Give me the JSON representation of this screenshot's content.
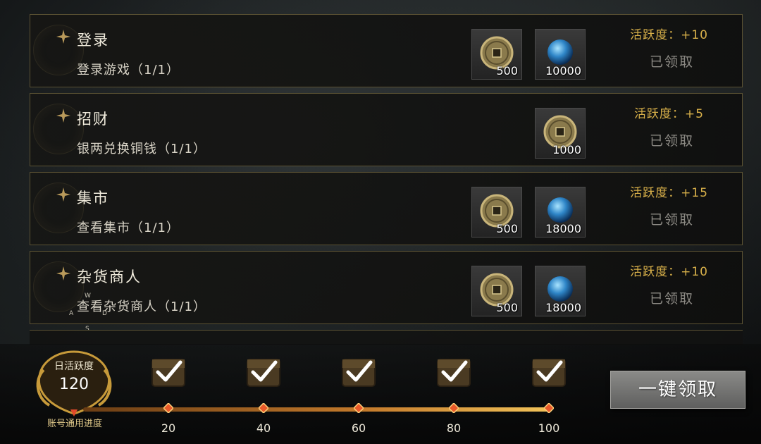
{
  "tasks": [
    {
      "title": "登录",
      "desc": "登录游戏（1/1）",
      "activity": "活跃度：+10",
      "status": "已领取",
      "rewards": [
        {
          "type": "coin-icon",
          "amount": "500"
        },
        {
          "type": "orb-icon",
          "amount": "10000"
        }
      ]
    },
    {
      "title": "招财",
      "desc": "银两兑换铜钱（1/1）",
      "activity": "活跃度：+5",
      "status": "已领取",
      "rewards": [
        {
          "type": "coin-icon",
          "amount": "1000"
        }
      ]
    },
    {
      "title": "集市",
      "desc": "查看集市（1/1）",
      "activity": "活跃度：+15",
      "status": "已领取",
      "rewards": [
        {
          "type": "coin-icon",
          "amount": "500"
        },
        {
          "type": "orb-icon",
          "amount": "18000"
        }
      ]
    },
    {
      "title": "杂货商人",
      "desc": "查看杂货商人（1/1）",
      "activity": "活跃度：+10",
      "status": "已领取",
      "rewards": [
        {
          "type": "coin-icon",
          "amount": "500"
        },
        {
          "type": "orb-icon",
          "amount": "18000"
        }
      ]
    }
  ],
  "progress": {
    "label": "日活跃度",
    "value": "120",
    "sub_label": "账号通用进度",
    "milestones": [
      "20",
      "40",
      "60",
      "80",
      "100"
    ],
    "fill_fraction": 1.0
  },
  "claim_all_label": "一键领取",
  "keys": {
    "w": "W",
    "a": "A",
    "s": "S",
    "d": "D"
  },
  "colors": {
    "gold": "#d9b14a",
    "frame": "#5b5233",
    "claimed": "#8c8a84"
  }
}
